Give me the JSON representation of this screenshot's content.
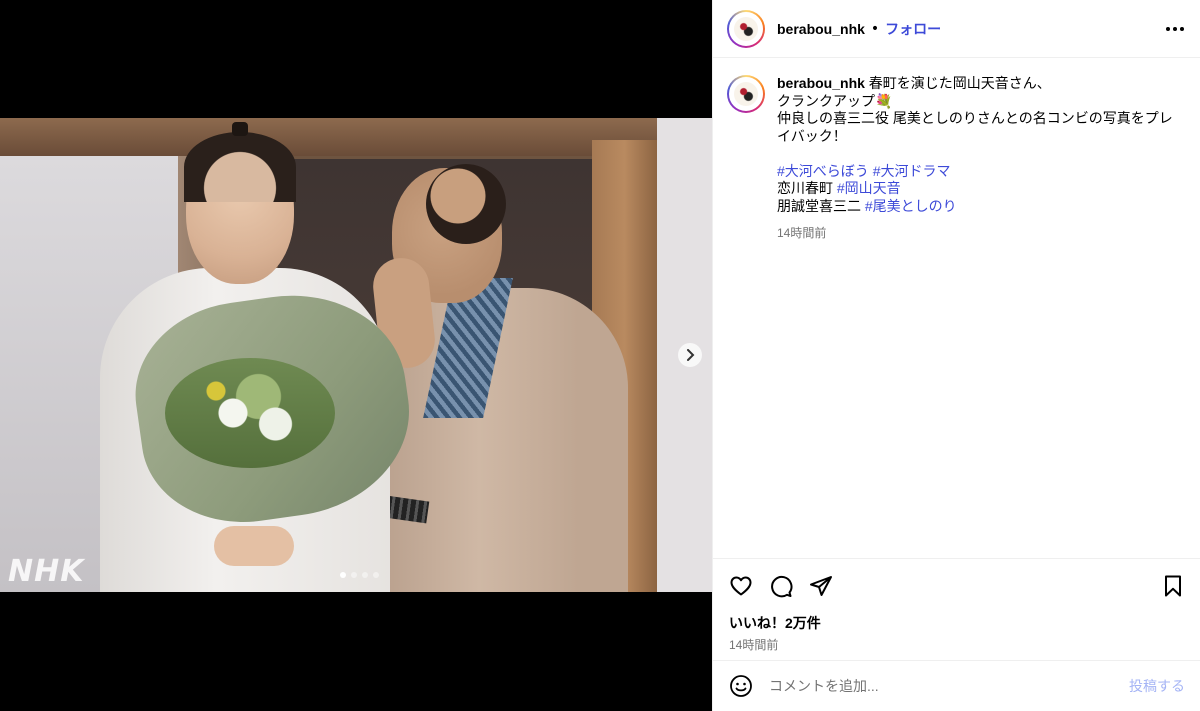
{
  "post": {
    "username": "berabou_nhk",
    "separator": "•",
    "follow_label": "フォロー",
    "more_icon": "more-horizontal-icon",
    "media": {
      "watermark": "NHK",
      "carousel_count": 4,
      "carousel_active": 1,
      "next_icon": "chevron-right-icon"
    },
    "caption": {
      "username": "berabou_nhk",
      "line1": " 春町を演じた岡山天音さん、",
      "line2": "クランクアップ💐",
      "line3": "仲良しの喜三二役 尾美としのりさんとの名コンビの写真をプレイバック！",
      "hashtag1": "#大河べらぼう",
      "hashtag2": "#大河ドラマ",
      "role1": "恋川春町 ",
      "hashtag3": "#岡山天音",
      "role2": "朋誠堂喜三二 ",
      "hashtag4": "#尾美としのり",
      "time": "14時間前"
    },
    "actions": {
      "like_icon": "heart-icon",
      "comment_icon": "comment-icon",
      "share_icon": "share-icon",
      "save_icon": "bookmark-icon"
    },
    "likes": "いいね！2万件",
    "time": "14時間前",
    "comment": {
      "emoji_icon": "smiley-icon",
      "placeholder": "コメントを追加...",
      "post_label": "投稿する"
    }
  }
}
